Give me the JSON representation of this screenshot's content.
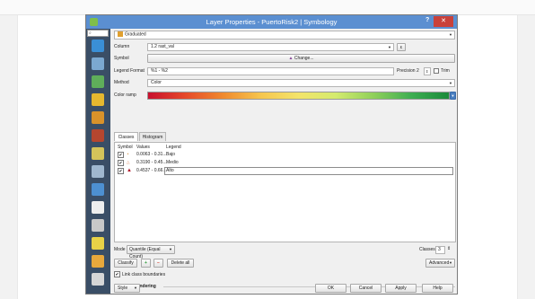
{
  "window": {
    "title": "Layer Properties - PuertoRisk2 | Symbology",
    "help": "?",
    "close": "✕"
  },
  "sidebar": {
    "search_icon": "⌕",
    "icons": [
      {
        "name": "information-icon",
        "color": "#3a8fd6"
      },
      {
        "name": "source-icon",
        "color": "#7ba8d0"
      },
      {
        "name": "symbology-icon",
        "color": "#5fae5a"
      },
      {
        "name": "labels-icon",
        "color": "#e6b82f"
      },
      {
        "name": "diagrams-icon",
        "color": "#d9922a"
      },
      {
        "name": "3d-view-icon",
        "color": "#b5462f"
      },
      {
        "name": "fields-icon",
        "color": "#d4c35a"
      },
      {
        "name": "attributes-form-icon",
        "color": "#9fb7cf"
      },
      {
        "name": "joins-icon",
        "color": "#4d90d1"
      },
      {
        "name": "auxiliary-storage-icon",
        "color": "#eeeeee"
      },
      {
        "name": "actions-icon",
        "color": "#c8c8c8"
      },
      {
        "name": "display-icon",
        "color": "#e8d247"
      },
      {
        "name": "rendering-icon",
        "color": "#e8a83c"
      },
      {
        "name": "variables-icon",
        "color": "#d6d6d6"
      }
    ]
  },
  "renderer": {
    "value": "Graduated"
  },
  "column": {
    "label": "Column",
    "value": "1.2 rast_val"
  },
  "symbol": {
    "label": "Symbol",
    "button": "Change..."
  },
  "legend_format": {
    "label": "Legend Format",
    "value": "%1 - %2",
    "precision_label": "Precision 2",
    "trim_label": "Trim"
  },
  "method": {
    "label": "Method",
    "value": "Color"
  },
  "color_ramp": {
    "label": "Color ramp"
  },
  "tabs": [
    {
      "label": "Classes"
    },
    {
      "label": "Histogram"
    }
  ],
  "classes_table": {
    "headers": [
      "Symbol",
      "Values",
      "Legend"
    ],
    "rows": [
      {
        "values": "0.0063 - 0.31...",
        "legend": "Bajo",
        "color": "#d9a05b",
        "checked": "✔"
      },
      {
        "values": "0.3190 - 0.45...",
        "legend": "Medio",
        "color": "#d97b4a",
        "checked": "✔"
      },
      {
        "values": "0.4537 - 0.66...",
        "legend": "Alto",
        "color": "#b0182a",
        "checked": "✔"
      }
    ]
  },
  "mode": {
    "label": "Mode",
    "value": "Quantile (Equal Count)",
    "classes_label": "Classes",
    "classes_value": "3"
  },
  "buttons": {
    "classify": "Classify",
    "add": "+",
    "remove": "−",
    "delete_all": "Delete all",
    "advanced": "Advanced"
  },
  "link_boundaries": {
    "label": "Link class boundaries",
    "checked": "✔"
  },
  "layer_rendering": {
    "label": "Layer rendering"
  },
  "footer": {
    "style": "Style",
    "ok": "OK",
    "cancel": "Cancel",
    "apply": "Apply",
    "help": "Help"
  }
}
